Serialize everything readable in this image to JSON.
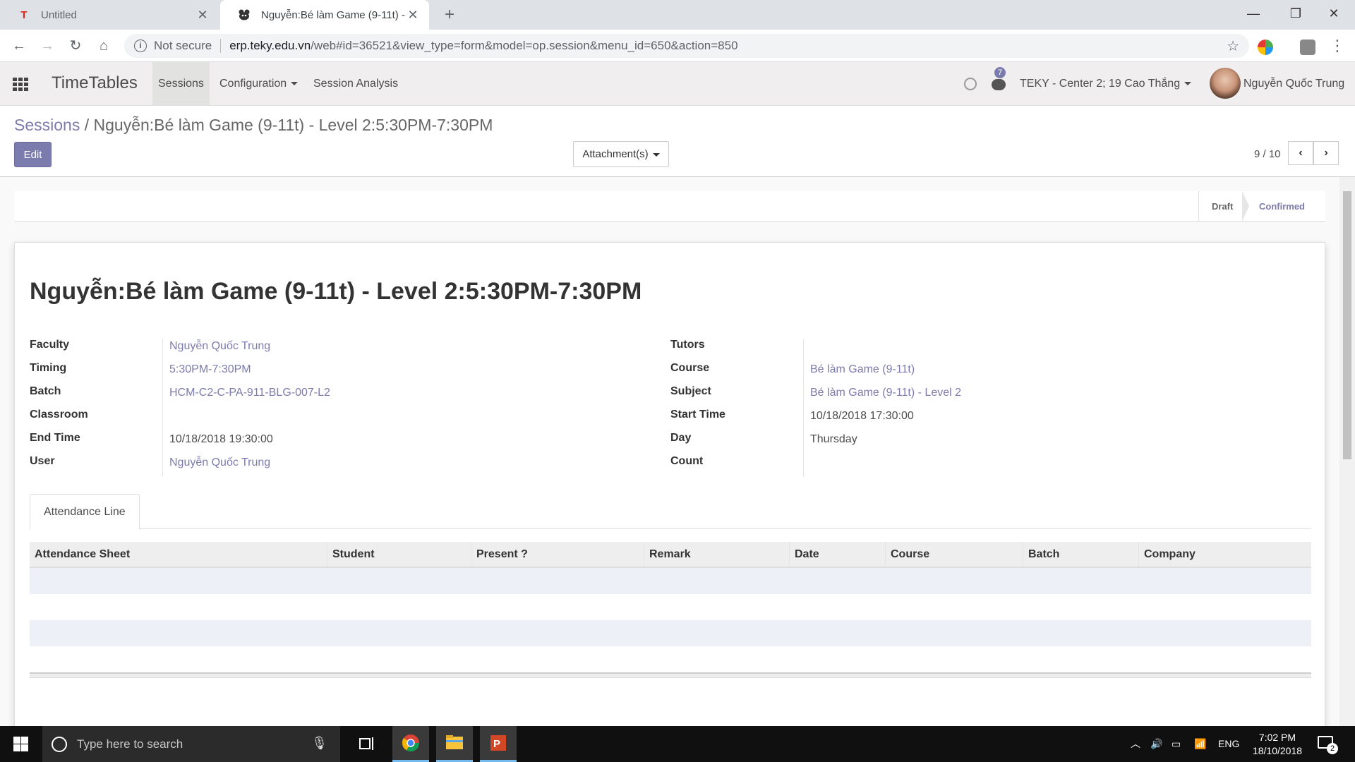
{
  "browser": {
    "tabs": [
      {
        "title": "Untitled",
        "active": false
      },
      {
        "title": "Nguyễn:Bé làm Game (9-11t) - Le",
        "active": true
      }
    ],
    "address": {
      "security": "Not secure",
      "host": "erp.teky.edu.vn",
      "path": "/web#id=36521&view_type=form&model=op.session&menu_id=650&action=850"
    }
  },
  "app": {
    "name": "TimeTables",
    "menus": [
      {
        "label": "Sessions",
        "active": true
      },
      {
        "label": "Configuration",
        "dropdown": true
      },
      {
        "label": "Session Analysis"
      }
    ],
    "message_count": "7",
    "company": "TEKY - Center 2; 19 Cao Thắng",
    "user": "Nguyễn Quốc Trung"
  },
  "control_panel": {
    "breadcrumb_parent": "Sessions",
    "breadcrumb_sep": "/",
    "breadcrumb_current": "Nguyễn:Bé làm Game (9-11t) - Level 2:5:30PM-7:30PM",
    "edit_label": "Edit",
    "attachments_label": "Attachment(s)",
    "pager": "9 / 10"
  },
  "statusbar": {
    "stages": [
      {
        "label": "Draft",
        "active": false
      },
      {
        "label": "Confirmed",
        "active": true
      }
    ]
  },
  "record": {
    "title": "Nguyễn:Bé làm Game (9-11t) - Level 2:5:30PM-7:30PM",
    "left_fields": [
      {
        "label": "Faculty",
        "value": "Nguyễn Quốc Trung",
        "link": true
      },
      {
        "label": "Timing",
        "value": "5:30PM-7:30PM",
        "link": true
      },
      {
        "label": "Batch",
        "value": "HCM-C2-C-PA-911-BLG-007-L2",
        "link": true
      },
      {
        "label": "Classroom",
        "value": "",
        "link": false
      },
      {
        "label": "End Time",
        "value": "10/18/2018 19:30:00",
        "link": false
      },
      {
        "label": "User",
        "value": "Nguyễn Quốc Trung",
        "link": true
      }
    ],
    "right_fields": [
      {
        "label": "Tutors",
        "value": "",
        "link": false
      },
      {
        "label": "Course",
        "value": "Bé làm Game (9-11t)",
        "link": true
      },
      {
        "label": "Subject",
        "value": "Bé làm Game (9-11t) - Level 2",
        "link": true
      },
      {
        "label": "Start Time",
        "value": "10/18/2018 17:30:00",
        "link": false
      },
      {
        "label": "Day",
        "value": "Thursday",
        "link": false
      },
      {
        "label": "Count",
        "value": "",
        "link": false
      }
    ],
    "notebook_tab": "Attendance Line",
    "table_columns": [
      "Attendance Sheet",
      "Student",
      "Present ?",
      "Remark",
      "Date",
      "Course",
      "Batch",
      "Company"
    ]
  },
  "taskbar": {
    "search_placeholder": "Type here to search",
    "language": "ENG",
    "time": "7:02 PM",
    "date": "18/10/2018",
    "notifications": "2"
  },
  "colors": {
    "accent": "#7c7bad",
    "link": "#7c7bad",
    "nav_bg": "#f0eeee"
  }
}
